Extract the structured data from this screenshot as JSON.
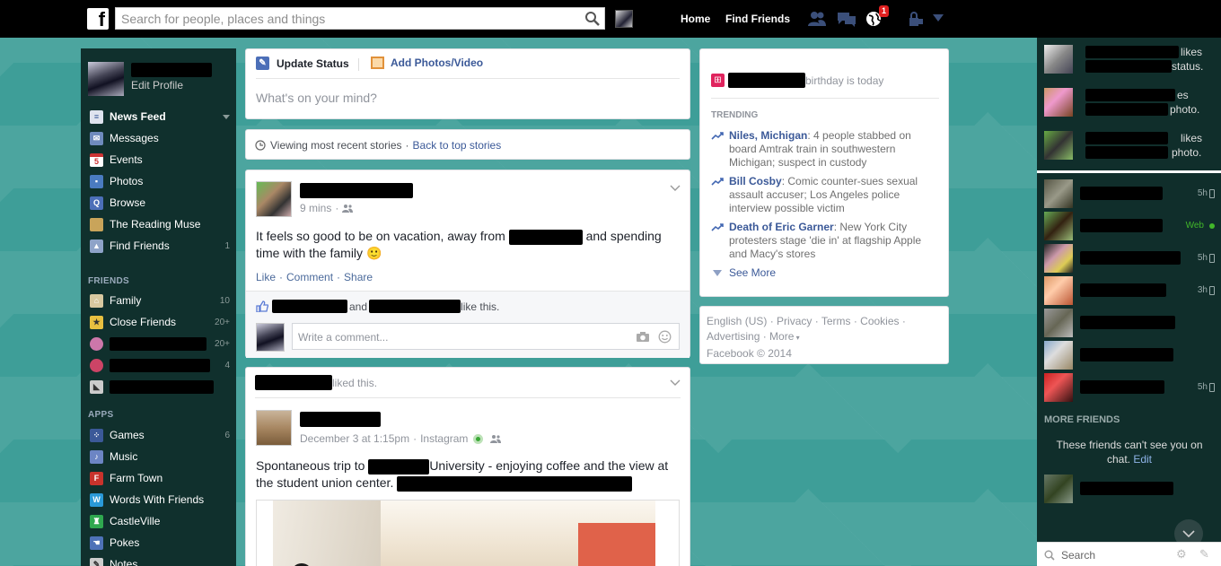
{
  "topbar": {
    "logo": "f",
    "search_placeholder": "Search for people, places and things",
    "nav_home": "Home",
    "nav_find_friends": "Find Friends",
    "notification_count": "1"
  },
  "sidebar": {
    "edit_profile": "Edit Profile",
    "items": [
      {
        "label": "News Feed",
        "icon": "news-feed-icon",
        "color": "#dfe3ee"
      },
      {
        "label": "Messages",
        "icon": "messages-icon",
        "color": "#6f8bbd"
      },
      {
        "label": "Events",
        "icon": "events-icon",
        "color": "#ffffff"
      },
      {
        "label": "Photos",
        "icon": "photos-icon",
        "color": "#4a7bc0"
      },
      {
        "label": "Browse",
        "icon": "browse-icon",
        "color": "#4c6fb8"
      },
      {
        "label": "The Reading Muse",
        "icon": "page-icon",
        "color": "#c9a45a"
      },
      {
        "label": "Find Friends",
        "icon": "find-friends-icon",
        "color": "#8ea3c8",
        "count": "1"
      }
    ],
    "friends_header": "FRIENDS",
    "friends": [
      {
        "label": "Family",
        "count": "10"
      },
      {
        "label": "Close Friends",
        "count": "20+"
      },
      {
        "label": "",
        "count": "20+"
      },
      {
        "label": "",
        "count": "4"
      },
      {
        "label": "",
        "count": ""
      }
    ],
    "apps_header": "APPS",
    "apps": [
      {
        "label": "Games",
        "count": "6",
        "color": "#3b5998"
      },
      {
        "label": "Music",
        "count": "",
        "color": "#6c85c4"
      },
      {
        "label": "Farm Town",
        "count": "",
        "color": "#c8332c"
      },
      {
        "label": "Words With Friends",
        "count": "",
        "color": "#2a9ad8"
      },
      {
        "label": "CastleVille",
        "count": "",
        "color": "#2fa84f"
      },
      {
        "label": "Pokes",
        "count": "",
        "color": "#4e72b8"
      },
      {
        "label": "Notes",
        "count": "",
        "color": "#ccc"
      }
    ]
  },
  "composer": {
    "update_status": "Update Status",
    "add_photos": "Add Photos/Video",
    "placeholder": "What's on your mind?"
  },
  "stories_bar": {
    "viewing": "Viewing most recent stories",
    "separator": "·",
    "back": "Back to top stories"
  },
  "post1": {
    "time": "9 mins",
    "dot": "·",
    "text_part1": "It feels so good to be on vacation, away from",
    "text_part2": "and spending time with the family",
    "emoji": "🙂",
    "like": "Like",
    "comment": "Comment",
    "share": "Share",
    "likes_and": "and",
    "likes_suffix": "like this.",
    "comment_placeholder": "Write a comment..."
  },
  "post2": {
    "liked_this": "liked this.",
    "time": "December 3 at 1:15pm",
    "dot": "·",
    "via": "Instagram",
    "text_part1": "Spontaneous trip to",
    "text_part2": "University - enjoying coffee and the view at the student union center."
  },
  "birthday": {
    "text": "birthday is today"
  },
  "trending": {
    "header": "TRENDING",
    "items": [
      {
        "title": "Niles, Michigan",
        "desc": ": 4 people stabbed on board Amtrak train in southwestern Michigan; suspect in custody"
      },
      {
        "title": "Bill Cosby",
        "desc": ": Comic counter-sues sexual assault accuser; Los Angeles police interview possible victim"
      },
      {
        "title": "Death of Eric Garner",
        "desc": ": New York City protesters stage 'die in' at flagship Apple and Macy's stores"
      }
    ],
    "see_more": "See More"
  },
  "footer": {
    "english": "English (US)",
    "privacy": "Privacy",
    "terms": "Terms",
    "cookies": "Cookies",
    "advertising": "Advertising",
    "more": "More",
    "copyright": "Facebook © 2014"
  },
  "ticker": [
    {
      "suffix": "likes",
      "suffix2": "status."
    },
    {
      "suffix": "es",
      "suffix2": "photo."
    },
    {
      "suffix": "likes",
      "suffix2": "photo."
    }
  ],
  "chat": {
    "rows": [
      {
        "time": "5h",
        "online": false
      },
      {
        "time": "Web",
        "online": true
      },
      {
        "time": "5h",
        "online": false
      },
      {
        "time": "3h",
        "online": false
      },
      {
        "time": "",
        "online": false
      },
      {
        "time": "",
        "online": false
      },
      {
        "time": "5h",
        "online": false
      }
    ],
    "more_friends": "MORE FRIENDS",
    "cant_see": "These friends can't see you on chat.",
    "edit": "Edit",
    "search_placeholder": "Search"
  }
}
